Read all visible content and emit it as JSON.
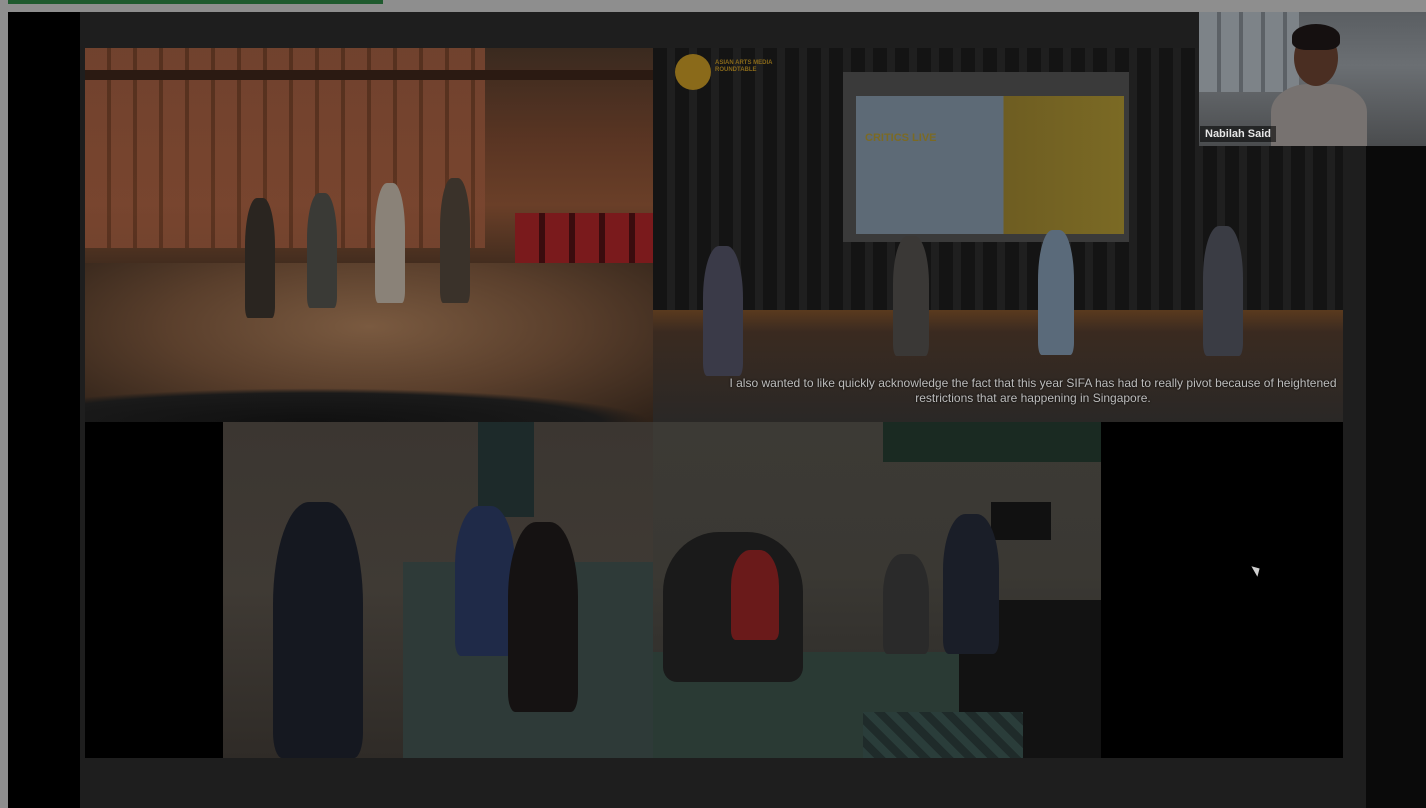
{
  "shared_slide": {
    "caption": "I also wanted to like quickly acknowledge the fact that this year SIFA has had to really pivot because of heightened restrictions that are happening in Singapore.",
    "logo_text": "ASIAN ARTS MEDIA ROUNDTABLE",
    "projection_title": "CRITICS LIVE"
  },
  "participant": {
    "name": "Nabilah Said"
  },
  "colors": {
    "progress_bar": "#1f5a2e",
    "slide_background": "#1e1e1e"
  }
}
